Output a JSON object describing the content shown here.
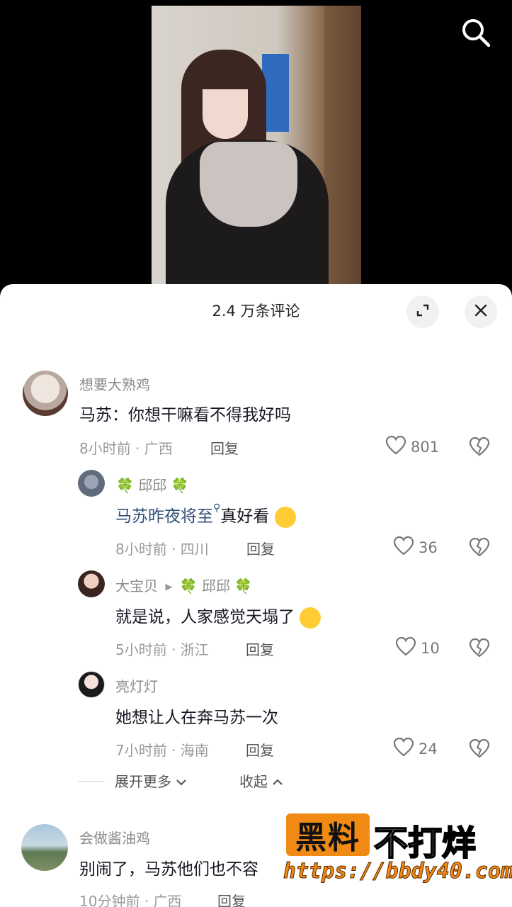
{
  "sheet": {
    "title": "2.4 万条评论"
  },
  "comments": [
    {
      "username": "想要大熟鸡",
      "content": "马苏：你想干嘛看不得我好吗",
      "meta": "8小时前 · 广西",
      "reply_label": "回复",
      "likes": "801"
    },
    {
      "username_prefix": "🍀",
      "username": "邱邱",
      "username_suffix": "🍀",
      "content_link": "马苏昨夜将至",
      "content_rest": "真好看",
      "meta": "8小时前 · 四川",
      "reply_label": "回复",
      "likes": "36"
    },
    {
      "username": "大宝贝",
      "reply_arrow": "▸",
      "reply_to_prefix": "🍀",
      "reply_to": "邱邱",
      "reply_to_suffix": "🍀",
      "content": "就是说，人家感觉天塌了",
      "meta": "5小时前 · 浙江",
      "reply_label": "回复",
      "likes": "10"
    },
    {
      "username": "亮灯灯",
      "content": "她想让人在奔马苏一次",
      "meta": "7小时前 · 海南",
      "reply_label": "回复",
      "likes": "24"
    },
    {
      "username": "会做酱油鸡",
      "content": "别闹了，马苏他们也不容",
      "meta": "10分钟前 · 广西",
      "reply_label": "回复"
    }
  ],
  "replies_controls": {
    "expand_more": "展开更多",
    "collapse": "收起"
  },
  "watermark": {
    "box": "黑料",
    "text": "不打烊",
    "url": "https://bbdy40.com"
  },
  "icons": {
    "search": "search-icon",
    "expand": "expand-icon",
    "close": "close-icon",
    "like": "heart-icon",
    "dislike": "broken-heart-icon"
  }
}
